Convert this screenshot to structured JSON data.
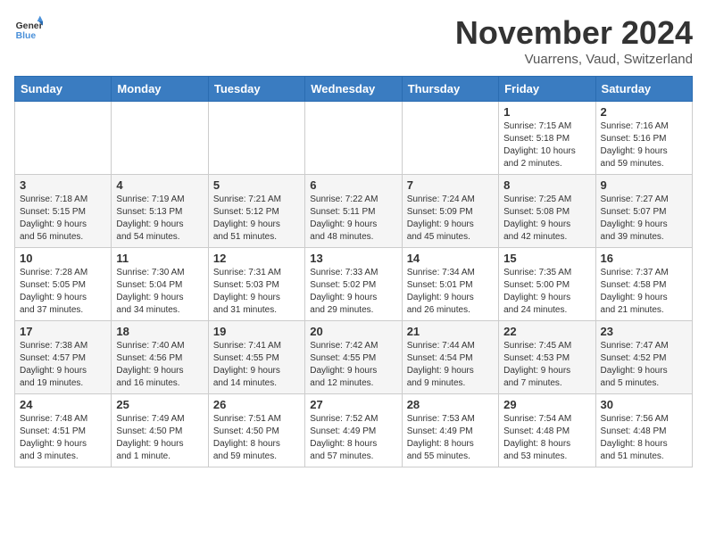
{
  "header": {
    "logo_line1": "General",
    "logo_line2": "Blue",
    "month_title": "November 2024",
    "location": "Vuarrens, Vaud, Switzerland"
  },
  "weekdays": [
    "Sunday",
    "Monday",
    "Tuesday",
    "Wednesday",
    "Thursday",
    "Friday",
    "Saturday"
  ],
  "weeks": [
    [
      {
        "day": "",
        "info": ""
      },
      {
        "day": "",
        "info": ""
      },
      {
        "day": "",
        "info": ""
      },
      {
        "day": "",
        "info": ""
      },
      {
        "day": "",
        "info": ""
      },
      {
        "day": "1",
        "info": "Sunrise: 7:15 AM\nSunset: 5:18 PM\nDaylight: 10 hours\nand 2 minutes."
      },
      {
        "day": "2",
        "info": "Sunrise: 7:16 AM\nSunset: 5:16 PM\nDaylight: 9 hours\nand 59 minutes."
      }
    ],
    [
      {
        "day": "3",
        "info": "Sunrise: 7:18 AM\nSunset: 5:15 PM\nDaylight: 9 hours\nand 56 minutes."
      },
      {
        "day": "4",
        "info": "Sunrise: 7:19 AM\nSunset: 5:13 PM\nDaylight: 9 hours\nand 54 minutes."
      },
      {
        "day": "5",
        "info": "Sunrise: 7:21 AM\nSunset: 5:12 PM\nDaylight: 9 hours\nand 51 minutes."
      },
      {
        "day": "6",
        "info": "Sunrise: 7:22 AM\nSunset: 5:11 PM\nDaylight: 9 hours\nand 48 minutes."
      },
      {
        "day": "7",
        "info": "Sunrise: 7:24 AM\nSunset: 5:09 PM\nDaylight: 9 hours\nand 45 minutes."
      },
      {
        "day": "8",
        "info": "Sunrise: 7:25 AM\nSunset: 5:08 PM\nDaylight: 9 hours\nand 42 minutes."
      },
      {
        "day": "9",
        "info": "Sunrise: 7:27 AM\nSunset: 5:07 PM\nDaylight: 9 hours\nand 39 minutes."
      }
    ],
    [
      {
        "day": "10",
        "info": "Sunrise: 7:28 AM\nSunset: 5:05 PM\nDaylight: 9 hours\nand 37 minutes."
      },
      {
        "day": "11",
        "info": "Sunrise: 7:30 AM\nSunset: 5:04 PM\nDaylight: 9 hours\nand 34 minutes."
      },
      {
        "day": "12",
        "info": "Sunrise: 7:31 AM\nSunset: 5:03 PM\nDaylight: 9 hours\nand 31 minutes."
      },
      {
        "day": "13",
        "info": "Sunrise: 7:33 AM\nSunset: 5:02 PM\nDaylight: 9 hours\nand 29 minutes."
      },
      {
        "day": "14",
        "info": "Sunrise: 7:34 AM\nSunset: 5:01 PM\nDaylight: 9 hours\nand 26 minutes."
      },
      {
        "day": "15",
        "info": "Sunrise: 7:35 AM\nSunset: 5:00 PM\nDaylight: 9 hours\nand 24 minutes."
      },
      {
        "day": "16",
        "info": "Sunrise: 7:37 AM\nSunset: 4:58 PM\nDaylight: 9 hours\nand 21 minutes."
      }
    ],
    [
      {
        "day": "17",
        "info": "Sunrise: 7:38 AM\nSunset: 4:57 PM\nDaylight: 9 hours\nand 19 minutes."
      },
      {
        "day": "18",
        "info": "Sunrise: 7:40 AM\nSunset: 4:56 PM\nDaylight: 9 hours\nand 16 minutes."
      },
      {
        "day": "19",
        "info": "Sunrise: 7:41 AM\nSunset: 4:55 PM\nDaylight: 9 hours\nand 14 minutes."
      },
      {
        "day": "20",
        "info": "Sunrise: 7:42 AM\nSunset: 4:55 PM\nDaylight: 9 hours\nand 12 minutes."
      },
      {
        "day": "21",
        "info": "Sunrise: 7:44 AM\nSunset: 4:54 PM\nDaylight: 9 hours\nand 9 minutes."
      },
      {
        "day": "22",
        "info": "Sunrise: 7:45 AM\nSunset: 4:53 PM\nDaylight: 9 hours\nand 7 minutes."
      },
      {
        "day": "23",
        "info": "Sunrise: 7:47 AM\nSunset: 4:52 PM\nDaylight: 9 hours\nand 5 minutes."
      }
    ],
    [
      {
        "day": "24",
        "info": "Sunrise: 7:48 AM\nSunset: 4:51 PM\nDaylight: 9 hours\nand 3 minutes."
      },
      {
        "day": "25",
        "info": "Sunrise: 7:49 AM\nSunset: 4:50 PM\nDaylight: 9 hours\nand 1 minute."
      },
      {
        "day": "26",
        "info": "Sunrise: 7:51 AM\nSunset: 4:50 PM\nDaylight: 8 hours\nand 59 minutes."
      },
      {
        "day": "27",
        "info": "Sunrise: 7:52 AM\nSunset: 4:49 PM\nDaylight: 8 hours\nand 57 minutes."
      },
      {
        "day": "28",
        "info": "Sunrise: 7:53 AM\nSunset: 4:49 PM\nDaylight: 8 hours\nand 55 minutes."
      },
      {
        "day": "29",
        "info": "Sunrise: 7:54 AM\nSunset: 4:48 PM\nDaylight: 8 hours\nand 53 minutes."
      },
      {
        "day": "30",
        "info": "Sunrise: 7:56 AM\nSunset: 4:48 PM\nDaylight: 8 hours\nand 51 minutes."
      }
    ]
  ]
}
